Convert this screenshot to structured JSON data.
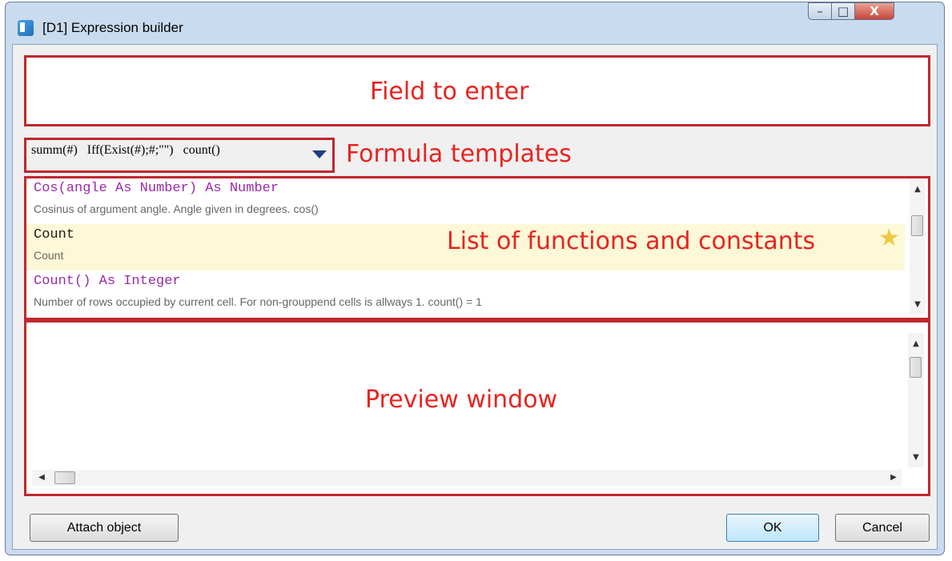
{
  "window": {
    "title": "[D1] Expression builder",
    "controls": {
      "minimize": "–",
      "maximize": "□",
      "close": "X"
    }
  },
  "annotations": {
    "field": "Field to enter",
    "templates": "Formula templates",
    "list": "List of functions and constants",
    "preview": "Preview window"
  },
  "templates": {
    "text": "summ(#)   Iff(Exist(#);#;\"\")   count()"
  },
  "function_list": [
    {
      "signature": "Cos(angle As Number) As Number",
      "description": "Cosinus of argument angle. Angle given in degrees. cos()",
      "color": "#9a2aa6",
      "highlighted": false
    },
    {
      "signature": "Count",
      "description": "Count",
      "color": "#1b1b1b",
      "highlighted": true,
      "favorite_icon": "star-icon"
    },
    {
      "signature": "Count() As Integer",
      "description": "Number of rows occupied by current cell. For non-grouppend cells is allways 1. count() = 1",
      "color": "#9a2aa6",
      "highlighted": false
    }
  ],
  "scroll_arrows": {
    "up": "▲",
    "down": "▼",
    "left": "◀",
    "right": "▶"
  },
  "buttons": {
    "attach": "Attach object",
    "ok": "OK",
    "cancel": "Cancel"
  },
  "colors": {
    "annotation": "#e8231f",
    "annotation_border": "#c0272d",
    "highlight_row": "#fdf8d7"
  }
}
